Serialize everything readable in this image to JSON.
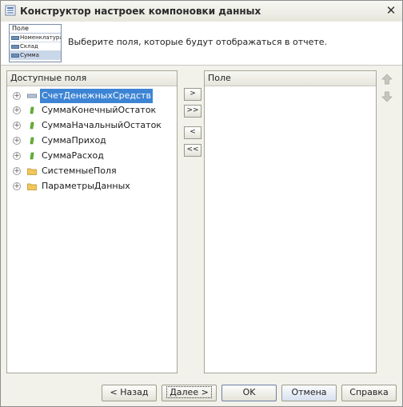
{
  "window": {
    "title": "Конструктор настроек компоновки данных"
  },
  "preview": {
    "header": "Поле",
    "rows": [
      "Номенклатура",
      "Склад",
      "Сумма"
    ]
  },
  "instruction": "Выберите поля, которые будут отображаться в отчете.",
  "available_fields": {
    "header": "Доступные поля",
    "items": [
      {
        "label": "СчетДенежныхСредств",
        "icon": "dimension-icon",
        "selected": true
      },
      {
        "label": "СуммаКонечныйОстаток",
        "icon": "resource-icon"
      },
      {
        "label": "СуммаНачальныйОстаток",
        "icon": "resource-icon"
      },
      {
        "label": "СуммаПриход",
        "icon": "resource-icon"
      },
      {
        "label": "СуммаРасход",
        "icon": "resource-icon"
      },
      {
        "label": "СистемныеПоля",
        "icon": "folder-icon"
      },
      {
        "label": "ПараметрыДанных",
        "icon": "folder-icon"
      }
    ]
  },
  "transfer_buttons": {
    "add": ">",
    "add_all": ">>",
    "remove": "<",
    "remove_all": "<<"
  },
  "selected_fields": {
    "header": "Поле"
  },
  "footer": {
    "back": "< Назад",
    "next": "Далее >",
    "ok": "OK",
    "cancel": "Отмена",
    "help": "Справка"
  },
  "colors": {
    "selection": "#3d84d4",
    "resource_icon": "#5fb52b",
    "folder_icon": "#f0c85a"
  }
}
